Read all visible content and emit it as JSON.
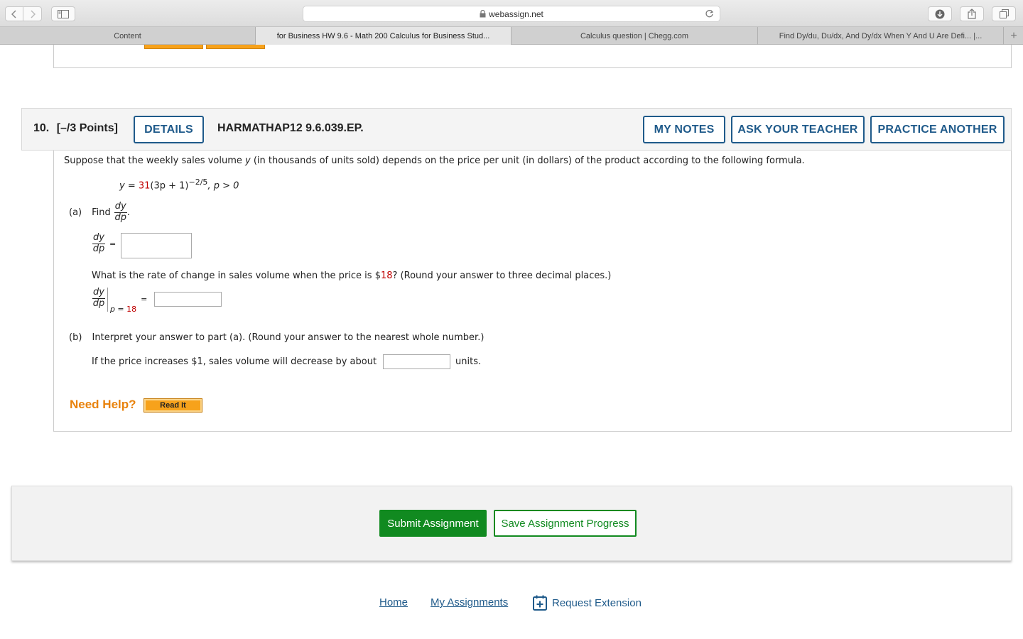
{
  "browser": {
    "url": "webassign.net",
    "tabs": [
      {
        "label": "Content",
        "active": false
      },
      {
        "label": "for Business HW 9.6 - Math 200 Calculus for Business Stud...",
        "active": true
      },
      {
        "label": "Calculus question | Chegg.com",
        "active": false
      },
      {
        "label": "Find Dy/du, Du/dx, And Dy/dx When Y And U Are Defi... |...",
        "active": false
      }
    ],
    "new_tab_label": "+"
  },
  "question": {
    "number": "10.",
    "points": "[–/3 Points]",
    "details_label": "DETAILS",
    "code": "HARMATHAP12 9.6.039.EP.",
    "my_notes_label": "MY NOTES",
    "ask_teacher_label": "ASK YOUR TEACHER",
    "practice_another_label": "PRACTICE ANOTHER",
    "intro_pre": "Suppose that the weekly sales volume",
    "intro_var": "y",
    "intro_post": "(in thousands of units sold) depends on the price per unit (in dollars) of the product according to the following formula.",
    "formula": {
      "lhs": "y =",
      "coef": "31",
      "body": "(3p + 1)",
      "exponent": "−2/5",
      "condition": ",  p > 0"
    },
    "part_a": {
      "label": "(a)",
      "find_text": "Find",
      "deriv_num": "dy",
      "deriv_den": "dp",
      "equals": "=",
      "rate_question_pre": "What is the rate of change in sales volume when the price is $",
      "rate_price": "18",
      "rate_question_post": "? (Round your answer to three decimal places.)",
      "eval_subscript_pre": "p = ",
      "eval_subscript_val": "18"
    },
    "part_b": {
      "label": "(b)",
      "prompt": "Interpret your answer to part (a). (Round your answer to the nearest whole number.)",
      "sentence_pre": "If the price increases $1, sales volume will decrease by about",
      "sentence_post": "units."
    },
    "need_help_label": "Need Help?",
    "read_it_label": "Read It"
  },
  "actions": {
    "submit_label": "Submit Assignment",
    "save_label": "Save Assignment Progress"
  },
  "footer": {
    "home_label": "Home",
    "my_assignments_label": "My Assignments",
    "request_extension_label": "Request Extension"
  },
  "colors": {
    "link_blue": "#1f5a8a",
    "submit_green": "#118a20",
    "help_orange": "#e8820c",
    "value_red": "#c00000"
  }
}
